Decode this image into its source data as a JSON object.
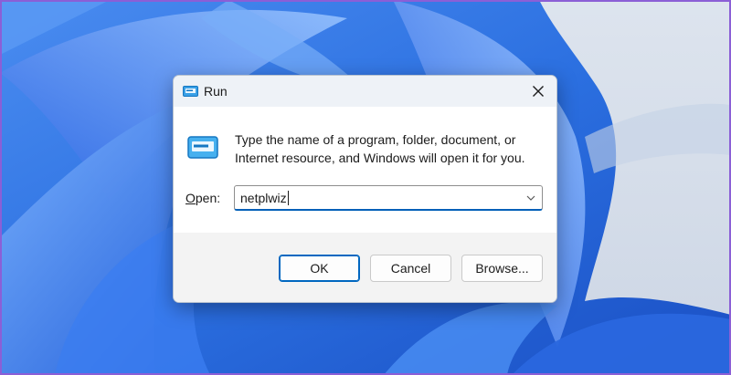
{
  "dialog": {
    "title": "Run",
    "description": "Type the name of a program, folder, document, or Internet resource, and Windows will open it for you.",
    "open_label_accel": "O",
    "open_label_rest": "pen:",
    "open_value": "netplwiz",
    "buttons": {
      "ok": "OK",
      "cancel": "Cancel",
      "browse": "Browse..."
    }
  },
  "icons": {
    "title": "run-icon",
    "body": "run-icon",
    "close": "close-icon",
    "dropdown": "chevron-down-icon"
  },
  "colors": {
    "wallpaper_base": "#2b6fe0",
    "accent": "#0067c0",
    "frame_border": "#8b5fd6"
  }
}
